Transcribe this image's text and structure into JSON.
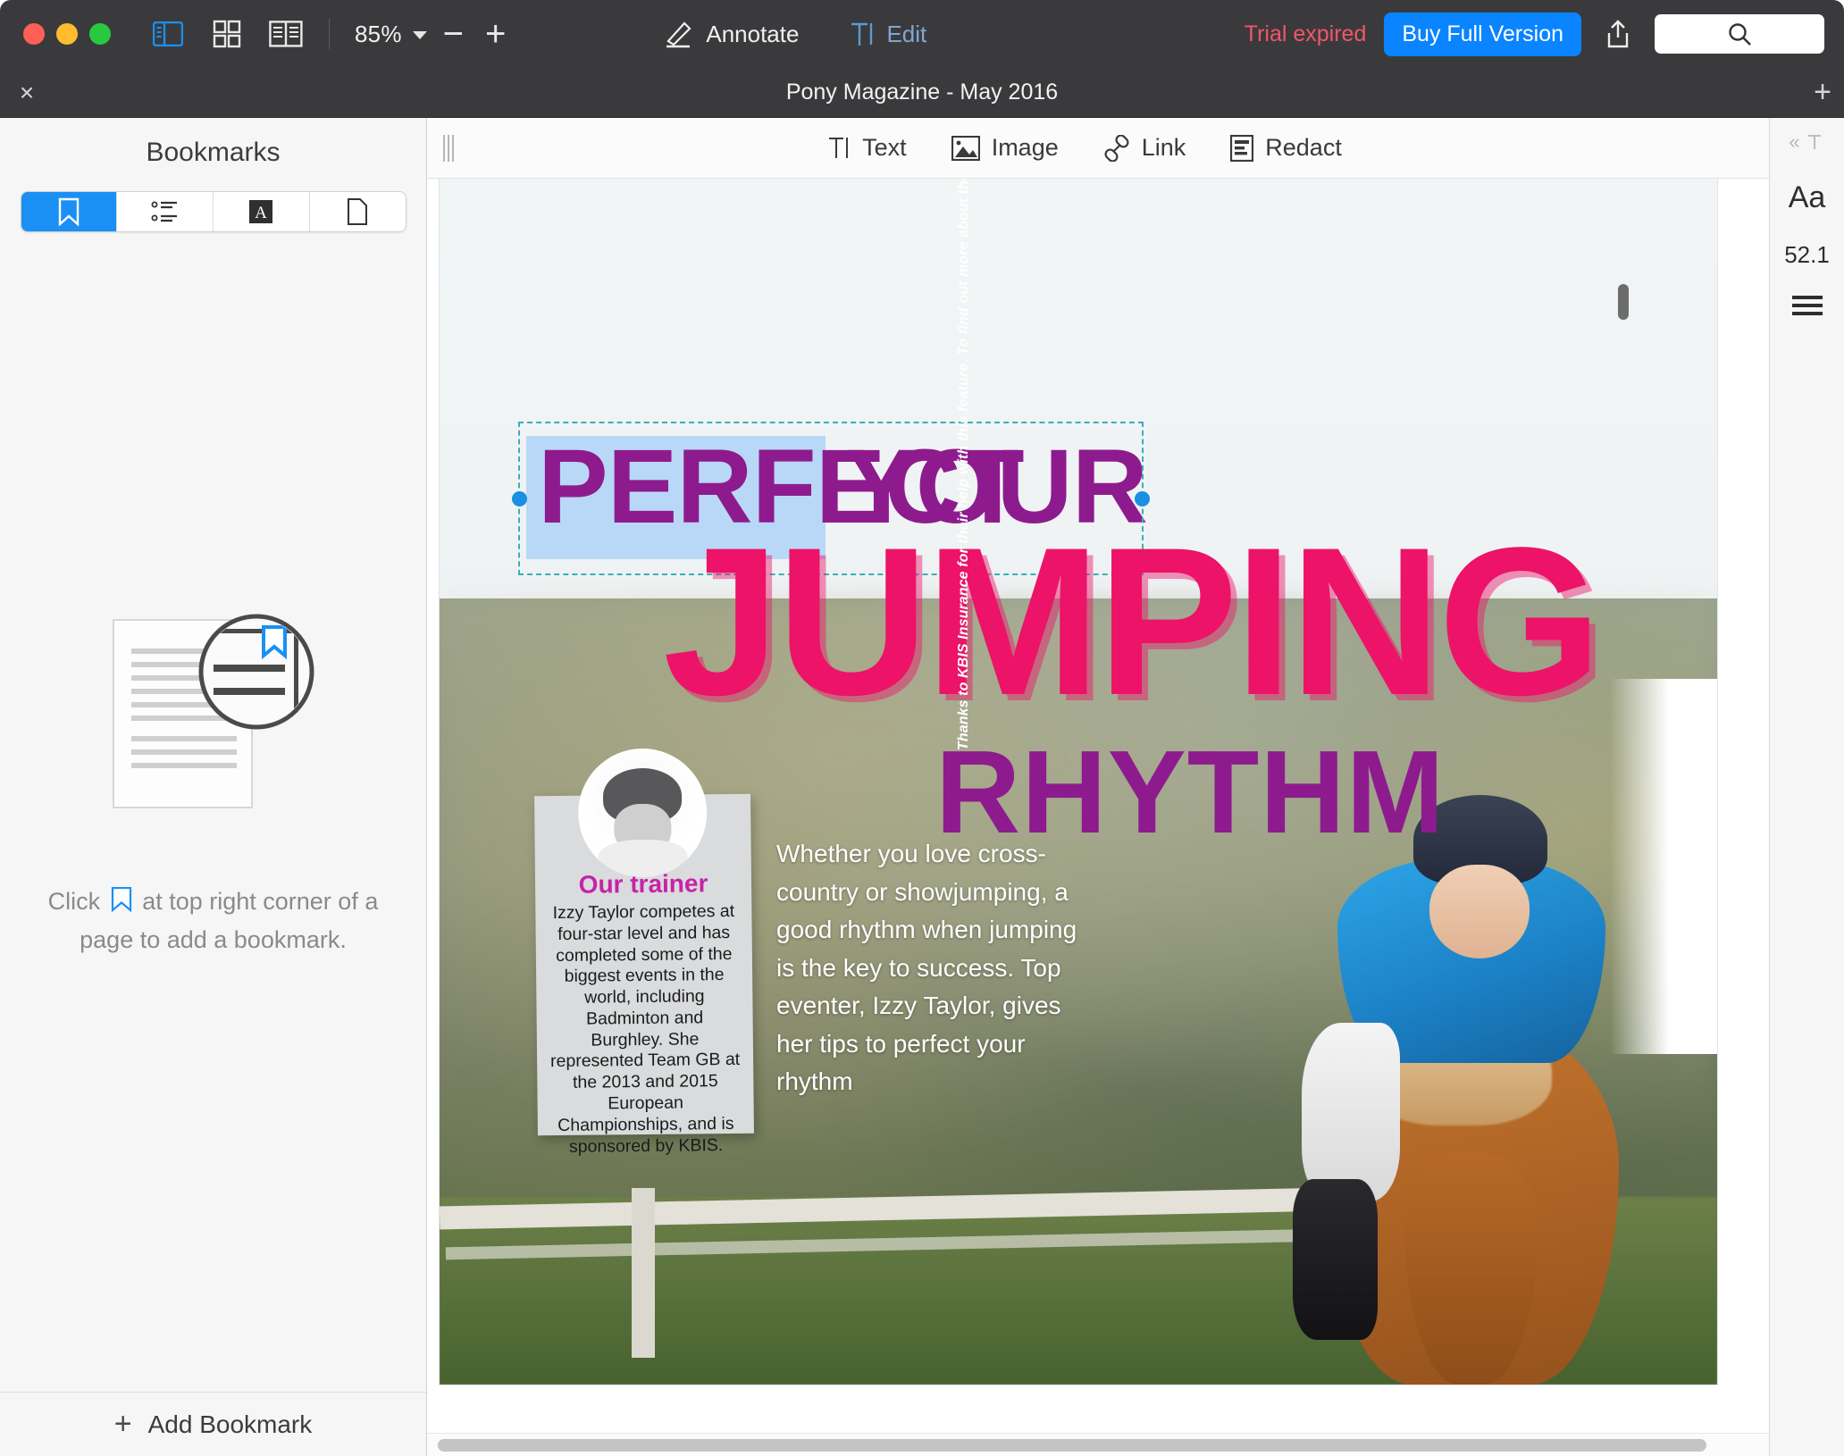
{
  "titlebar": {
    "zoom_level": "85%",
    "sidebar_icon": "sidebar-toggle-icon",
    "grid_icon": "grid-view-icon",
    "twopage_icon": "two-page-view-icon",
    "zoom_out_label": "−",
    "zoom_in_label": "+",
    "annotate_label": "Annotate",
    "edit_label": "Edit",
    "trial_label": "Trial expired",
    "buy_label": "Buy Full Version",
    "share_icon": "share-icon",
    "search_placeholder": "",
    "accent_blue": "#0a84ff",
    "trial_red": "#f1566a"
  },
  "tabbar": {
    "close_label": "×",
    "document_title": "Pony Magazine - May 2016",
    "new_tab_label": "+"
  },
  "sidebar": {
    "title": "Bookmarks",
    "tabs": [
      {
        "name": "bookmarks",
        "icon": "bookmark-icon",
        "active": true
      },
      {
        "name": "outline",
        "icon": "outline-list-icon",
        "active": false
      },
      {
        "name": "annotations",
        "icon": "annotations-a-icon",
        "active": false
      },
      {
        "name": "pages",
        "icon": "page-icon",
        "active": false
      }
    ],
    "empty_hint_before": "Click",
    "empty_hint_after": "at top right corner of a page to add a bookmark.",
    "add_bookmark_label": "Add Bookmark",
    "add_icon": "plus-icon"
  },
  "edit_toolbar": {
    "tools": [
      {
        "label": "Text",
        "icon": "text-tool-icon"
      },
      {
        "label": "Image",
        "icon": "image-tool-icon"
      },
      {
        "label": "Link",
        "icon": "link-tool-icon"
      },
      {
        "label": "Redact",
        "icon": "redact-tool-icon"
      }
    ]
  },
  "inspector": {
    "collapse_label": "«",
    "text_icon": "text-format-icon",
    "font_label": "Aa",
    "font_size": "52.1",
    "align_icon": "line-spacing-icon"
  },
  "document": {
    "headline": {
      "line1_word1": "PERFECT",
      "line1_word2": "YOUR",
      "line2": "JUMPING",
      "line3": "RHYTHM",
      "purple": "#8e1b8e",
      "pink": "#ec1368",
      "selected_word": "PERFECT",
      "selection_highlight_color": "#b9d8f7"
    },
    "intro_paragraph": "Whether you love cross-country or showjumping, a good rhythm when jumping is the key to success. Top eventer, Izzy Taylor, gives her tips to perfect your rhythm",
    "trainer_card": {
      "title": "Our trainer",
      "body": "Izzy Taylor competes at four-star level and has completed some of the biggest events in the world, including Badminton and Burghley. She represented Team GB at the 2013 and 2015 European Championships, and is sponsored by KBIS.",
      "avatar_icon": "trainer-avatar"
    },
    "vertical_credit": "Thanks to KBIS Insurance for their help with this feature. To find out more about the KBIS NSEA Training Bursary, visit kbis.co.uk"
  }
}
